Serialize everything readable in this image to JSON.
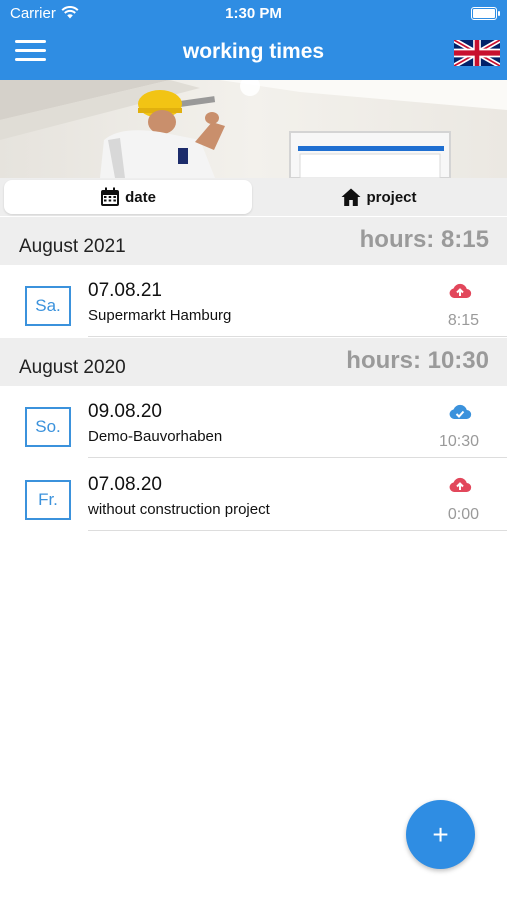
{
  "status_bar": {
    "carrier": "Carrier",
    "time": "1:30 PM"
  },
  "nav": {
    "title": "working times",
    "menu_icon": "hamburger-icon",
    "language_icon": "uk-flag-icon"
  },
  "tabs": [
    {
      "label": "date",
      "icon": "calendar-icon",
      "selected": true
    },
    {
      "label": "project",
      "icon": "home-icon",
      "selected": false
    }
  ],
  "sections": [
    {
      "month": "August 2021",
      "hours": "hours: 8:15",
      "entries": [
        {
          "weekday": "Sa.",
          "date": "07.08.21",
          "project": "Supermarkt Hamburg",
          "duration": "8:15",
          "sync": "cloud-upload-icon"
        }
      ]
    },
    {
      "month": "August 2020",
      "hours": "hours: 10:30",
      "entries": [
        {
          "weekday": "So.",
          "date": "09.08.20",
          "project": "Demo-Bauvorhaben",
          "duration": "10:30",
          "sync": "cloud-check-icon"
        },
        {
          "weekday": "Fr.",
          "date": "07.08.20",
          "project": "without construction project",
          "duration": "0:00",
          "sync": "cloud-upload-icon"
        }
      ]
    }
  ],
  "fab": {
    "label": "+"
  },
  "colors": {
    "primary": "#2f8de3",
    "upload_pending": "#e2475b",
    "synced": "#3b92dc",
    "muted": "#9a9a9a"
  }
}
